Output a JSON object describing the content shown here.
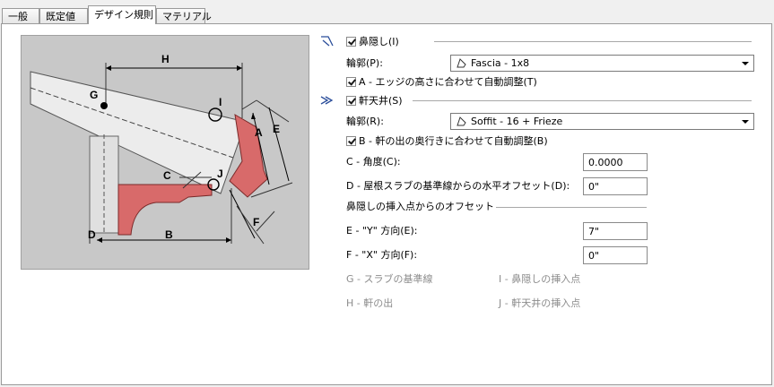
{
  "tabs": [
    {
      "label": "一般"
    },
    {
      "label": "既定値"
    },
    {
      "label": "デザイン規則"
    },
    {
      "label": "マテリアル"
    }
  ],
  "active_tab": "デザイン規則",
  "diagram": {
    "labels": {
      "H": "H",
      "G": "G",
      "I": "I",
      "E": "E",
      "A": "A",
      "C": "C",
      "J": "J",
      "F": "F",
      "D": "D",
      "B": "B"
    }
  },
  "fascia": {
    "label": "鼻隠し(I)",
    "checked": true,
    "profile_label": "輪郭(P):",
    "profile_value": "Fascia - 1x8",
    "auto_label": "A - エッジの高さに合わせて自動調整(T)",
    "auto_checked": true
  },
  "soffit": {
    "label": "軒天井(S)",
    "checked": true,
    "profile_label": "輪郭(R):",
    "profile_value": "Soffit - 16 + Frieze",
    "auto_label": "B - 軒の出の奥行きに合わせて自動調整(B)",
    "auto_checked": true
  },
  "angle": {
    "label": "C - 角度(C):",
    "value": "0.0000"
  },
  "offset_d": {
    "label": "D - 屋根スラブの基準線からの水平オフセット(D):",
    "value": "0\""
  },
  "insertion_offset": {
    "heading": "鼻隠しの挿入点からのオフセット"
  },
  "offset_e": {
    "label": "E - \"Y\" 方向(E):",
    "value": "7\""
  },
  "offset_f": {
    "label": "F - \"X\" 方向(F):",
    "value": "0\""
  },
  "legend": {
    "g": "G - スラブの基準線",
    "h": "H - 軒の出",
    "i": "I - 鼻隠しの挿入点",
    "j": "J - 軒天井の挿入点"
  }
}
